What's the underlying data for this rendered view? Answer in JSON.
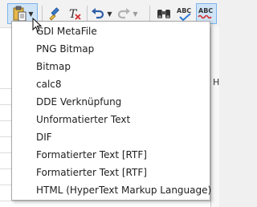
{
  "toolbar": {
    "buttons": [
      {
        "name": "paste",
        "icon": "clipboard-icon"
      },
      {
        "name": "clone-formatting",
        "icon": "paintbrush-icon"
      },
      {
        "name": "clear-formatting",
        "icon": "clear-format-icon"
      },
      {
        "name": "undo",
        "icon": "undo-icon"
      },
      {
        "name": "redo",
        "icon": "redo-icon"
      },
      {
        "name": "find-replace",
        "icon": "binoculars-icon"
      },
      {
        "name": "spelling",
        "icon": "spellcheck-icon"
      },
      {
        "name": "autospellcheck",
        "icon": "auto-spellcheck-icon"
      }
    ],
    "spell_label": "ABC",
    "autospell_label": "ABC",
    "colors": {
      "hover_bg": "#cfe4f7",
      "hover_border": "#7eb4ea",
      "accent_red": "#d32f2f"
    }
  },
  "sheet": {
    "column_header_partial": "H"
  },
  "paste_special_menu": {
    "items": [
      {
        "label": "GDI MetaFile"
      },
      {
        "label": "PNG Bitmap"
      },
      {
        "label": "Bitmap"
      },
      {
        "label": "calc8"
      },
      {
        "label": "DDE Verknüpfung"
      },
      {
        "label": "Unformatierter Text"
      },
      {
        "label": "DIF"
      },
      {
        "label": "Formatierter Text [RTF]"
      },
      {
        "label": "Formatierter Text [RTF]"
      },
      {
        "label": "HTML (HyperText Markup Language)"
      }
    ]
  }
}
